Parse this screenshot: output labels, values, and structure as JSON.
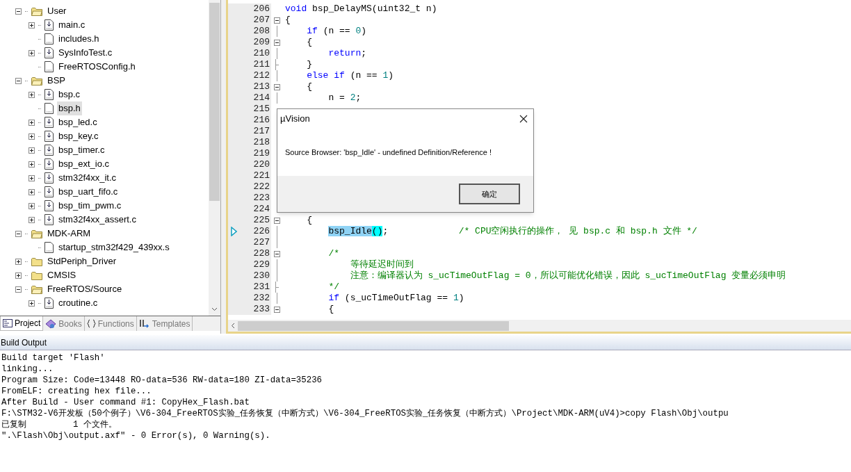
{
  "project_tree": [
    {
      "kind": "folder",
      "label": "User",
      "expanded": true,
      "selected": false,
      "children": [
        {
          "kind": "source",
          "label": "main.c",
          "expanded": false,
          "selected": false
        },
        {
          "kind": "header",
          "label": "includes.h",
          "selected": false
        },
        {
          "kind": "source",
          "label": "SysInfoTest.c",
          "expanded": false,
          "selected": false
        },
        {
          "kind": "header",
          "label": "FreeRTOSConfig.h",
          "selected": false
        }
      ]
    },
    {
      "kind": "folder",
      "label": "BSP",
      "expanded": true,
      "selected": false,
      "children": [
        {
          "kind": "source",
          "label": "bsp.c",
          "expanded": false,
          "selected": false
        },
        {
          "kind": "header",
          "label": "bsp.h",
          "selected": true
        },
        {
          "kind": "source",
          "label": "bsp_led.c",
          "expanded": false,
          "selected": false
        },
        {
          "kind": "source",
          "label": "bsp_key.c",
          "expanded": false,
          "selected": false
        },
        {
          "kind": "source",
          "label": "bsp_timer.c",
          "expanded": false,
          "selected": false
        },
        {
          "kind": "source",
          "label": "bsp_ext_io.c",
          "expanded": false,
          "selected": false
        },
        {
          "kind": "source",
          "label": "stm32f4xx_it.c",
          "expanded": false,
          "selected": false
        },
        {
          "kind": "source",
          "label": "bsp_uart_fifo.c",
          "expanded": false,
          "selected": false
        },
        {
          "kind": "source",
          "label": "bsp_tim_pwm.c",
          "expanded": false,
          "selected": false
        },
        {
          "kind": "source",
          "label": "stm32f4xx_assert.c",
          "expanded": false,
          "selected": false
        }
      ]
    },
    {
      "kind": "folder",
      "label": "MDK-ARM",
      "expanded": true,
      "selected": false,
      "children": [
        {
          "kind": "header",
          "label": "startup_stm32f429_439xx.s",
          "selected": false
        }
      ]
    },
    {
      "kind": "folder",
      "label": "StdPeriph_Driver",
      "expanded": false,
      "selected": false
    },
    {
      "kind": "folder",
      "label": "CMSIS",
      "expanded": false,
      "selected": false
    },
    {
      "kind": "folder",
      "label": "FreeRTOS/Source",
      "expanded": true,
      "selected": false,
      "children": [
        {
          "kind": "source",
          "label": "croutine.c",
          "expanded": false,
          "selected": false
        }
      ]
    }
  ],
  "panel_tabs": [
    {
      "kind": "project",
      "label": "Project",
      "selected": true
    },
    {
      "kind": "books",
      "label": "Books",
      "selected": false
    },
    {
      "kind": "functions",
      "label": "Functions",
      "selected": false
    },
    {
      "kind": "templates",
      "label": "Templates",
      "selected": false
    }
  ],
  "editor": {
    "lines": [
      {
        "number": "206",
        "kind": "plain",
        "current": false,
        "code": [
          {
            "kind": "keyword",
            "text": "void"
          },
          {
            "kind": "plain",
            "text": " bsp_DelayMS(uint32_t n)"
          }
        ]
      },
      {
        "number": "207",
        "kind": "fold_start",
        "current": false,
        "code": [
          {
            "kind": "plain",
            "text": "{"
          }
        ]
      },
      {
        "number": "208",
        "kind": "fold_body",
        "current": false,
        "code": [
          {
            "kind": "keyword",
            "text": "    if"
          },
          {
            "kind": "plain",
            "text": " (n == "
          },
          {
            "kind": "number",
            "text": "0"
          },
          {
            "kind": "plain",
            "text": ")"
          }
        ]
      },
      {
        "number": "209",
        "kind": "fold_start",
        "current": false,
        "code": [
          {
            "kind": "plain",
            "text": "    {"
          }
        ]
      },
      {
        "number": "210",
        "kind": "fold_body",
        "current": false,
        "code": [
          {
            "kind": "keyword",
            "text": "        return"
          },
          {
            "kind": "plain",
            "text": ";"
          }
        ]
      },
      {
        "number": "211",
        "kind": "fold_end",
        "current": false,
        "code": [
          {
            "kind": "plain",
            "text": "    }"
          }
        ]
      },
      {
        "number": "212",
        "kind": "fold_body",
        "current": false,
        "code": [
          {
            "kind": "keyword",
            "text": "    else if"
          },
          {
            "kind": "plain",
            "text": " (n == "
          },
          {
            "kind": "number",
            "text": "1"
          },
          {
            "kind": "plain",
            "text": ")"
          }
        ]
      },
      {
        "number": "213",
        "kind": "fold_start",
        "current": false,
        "code": [
          {
            "kind": "plain",
            "text": "    {"
          }
        ]
      },
      {
        "number": "214",
        "kind": "fold_body",
        "current": false,
        "code": [
          {
            "kind": "plain",
            "text": "        n = "
          },
          {
            "kind": "number",
            "text": "2"
          },
          {
            "kind": "plain",
            "text": ";"
          }
        ]
      },
      {
        "number": "215",
        "kind": "plain",
        "current": false
      },
      {
        "number": "216",
        "kind": "plain",
        "current": false
      },
      {
        "number": "217",
        "kind": "plain",
        "current": false
      },
      {
        "number": "218",
        "kind": "plain",
        "current": false
      },
      {
        "number": "219",
        "kind": "plain",
        "current": false
      },
      {
        "number": "220",
        "kind": "plain",
        "current": false
      },
      {
        "number": "221",
        "kind": "plain",
        "current": false
      },
      {
        "number": "222",
        "kind": "plain",
        "current": false
      },
      {
        "number": "223",
        "kind": "plain",
        "current": false
      },
      {
        "number": "224",
        "kind": "plain",
        "current": false
      },
      {
        "number": "225",
        "kind": "fold_start",
        "current": false,
        "code": [
          {
            "kind": "plain",
            "text": "    {"
          }
        ]
      },
      {
        "number": "226",
        "kind": "fold_body",
        "current": true,
        "code": [
          {
            "kind": "match",
            "text": "        bsp_Idle"
          },
          {
            "kind": "brace",
            "text": "()"
          },
          {
            "kind": "plain",
            "text": ";"
          },
          {
            "kind": "comment",
            "text": "             /* CPU空闲执行的操作， 见 bsp.c 和 bsp.h 文件 */"
          }
        ]
      },
      {
        "number": "227",
        "kind": "fold_body",
        "current": false
      },
      {
        "number": "228",
        "kind": "fold_start",
        "current": false,
        "code": [
          {
            "kind": "comment",
            "text": "        /*"
          }
        ]
      },
      {
        "number": "229",
        "kind": "fold_body",
        "current": false,
        "code": [
          {
            "kind": "comment",
            "text": "            等待延迟时间到"
          }
        ]
      },
      {
        "number": "230",
        "kind": "fold_body",
        "current": false,
        "code": [
          {
            "kind": "comment",
            "text": "            注意：编译器认为 s_ucTimeOutFlag = 0，所以可能优化错误，因此 s_ucTimeOutFlag 变量必须申明"
          }
        ]
      },
      {
        "number": "231",
        "kind": "fold_end",
        "current": false,
        "code": [
          {
            "kind": "comment",
            "text": "        */"
          }
        ]
      },
      {
        "number": "232",
        "kind": "fold_body",
        "current": false,
        "code": [
          {
            "kind": "keyword",
            "text": "        if"
          },
          {
            "kind": "plain",
            "text": " (s_ucTimeOutFlag == "
          },
          {
            "kind": "number",
            "text": "1"
          },
          {
            "kind": "plain",
            "text": ")"
          }
        ]
      },
      {
        "number": "233",
        "kind": "fold_start",
        "current": false,
        "code": [
          {
            "kind": "plain",
            "text": "        {"
          }
        ]
      }
    ]
  },
  "dialog": {
    "title": "µVision",
    "message": "Source Browser: 'bsp_Idle' - undefined Definition/Reference !",
    "button": "确定"
  },
  "build_output": {
    "title": "Build Output",
    "lines": [
      "Build target 'Flash'",
      "linking...",
      "Program Size: Code=13448 RO-data=536 RW-data=180 ZI-data=35236",
      "FromELF: creating hex file...",
      "After Build - User command #1: CopyHex_Flash.bat",
      "F:\\STM32-V6开发板（50个例子）\\V6-304_FreeRTOS实验_任务恢复（中断方式）\\V6-304_FreeRTOS实验_任务恢复（中断方式）\\Project\\MDK-ARM(uV4)>copy Flash\\Obj\\outpu",
      "已复制         1 个文件。",
      "\".\\Flash\\Obj\\output.axf\" - 0 Error(s), 0 Warning(s)."
    ]
  }
}
